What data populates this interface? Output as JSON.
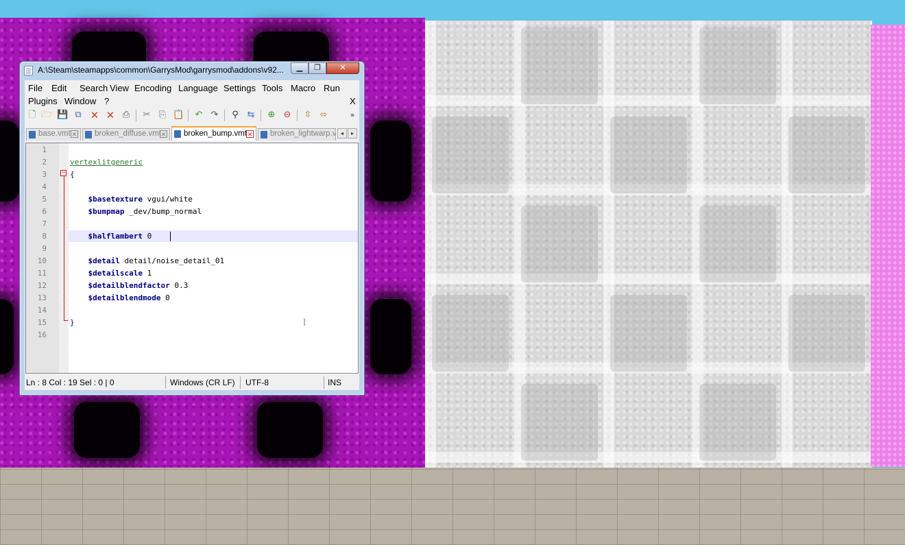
{
  "window": {
    "title": "A:\\Steam\\steamapps\\common\\GarrysMod\\garrysmod\\addons\\v92...",
    "min_glyph": "▁",
    "max_glyph": "❐",
    "close_glyph": "✕"
  },
  "menubar": {
    "row1": [
      "File",
      "Edit",
      "Search",
      "View",
      "Encoding",
      "Language",
      "Settings",
      "Tools",
      "Macro",
      "Run"
    ],
    "row2": [
      "Plugins",
      "Window",
      "?"
    ],
    "close_label": "X"
  },
  "toolbar": {
    "icons": [
      "new-file-icon",
      "open-file-icon",
      "save-icon",
      "save-all-icon",
      "close-icon",
      "close-all-icon",
      "print-icon",
      "cut-icon",
      "copy-icon",
      "paste-icon",
      "undo-icon",
      "redo-icon",
      "find-icon",
      "replace-icon",
      "zoom-in-icon",
      "zoom-out-icon",
      "sync-vertical-icon",
      "sync-horizontal-icon"
    ],
    "overflow": "»"
  },
  "tabs": [
    {
      "label": "base.vmt",
      "active": false
    },
    {
      "label": "broken_diffuse.vmt",
      "active": false
    },
    {
      "label": "broken_bump.vmt",
      "active": true
    },
    {
      "label": "broken_lightwarp.vmt",
      "active": false
    }
  ],
  "tab_nav": {
    "prev": "◂",
    "next": "▸"
  },
  "editor": {
    "lines": [
      {
        "n": "1",
        "kw": "",
        "rest": ""
      },
      {
        "n": "2",
        "kw": "",
        "rest": "vertexlitgeneric"
      },
      {
        "n": "3",
        "kw": "",
        "rest": "{"
      },
      {
        "n": "4",
        "kw": "",
        "rest": ""
      },
      {
        "n": "5",
        "kw": "    $basetexture",
        "rest": " vgui/white"
      },
      {
        "n": "6",
        "kw": "    $bumpmap",
        "rest": " _dev/bump_normal"
      },
      {
        "n": "7",
        "kw": "",
        "rest": ""
      },
      {
        "n": "8",
        "kw": "    $halflambert",
        "rest": " 0"
      },
      {
        "n": "9",
        "kw": "",
        "rest": ""
      },
      {
        "n": "10",
        "kw": "    $detail",
        "rest": " detail/noise_detail_01"
      },
      {
        "n": "11",
        "kw": "    $detailscale",
        "rest": " 1"
      },
      {
        "n": "12",
        "kw": "    $detailblendfactor",
        "rest": " 0.3"
      },
      {
        "n": "13",
        "kw": "    $detailblendmode",
        "rest": " 0"
      },
      {
        "n": "14",
        "kw": "",
        "rest": ""
      },
      {
        "n": "15",
        "kw": "",
        "rest": "}"
      },
      {
        "n": "16",
        "kw": "",
        "rest": ""
      }
    ],
    "fold_marker": "−",
    "ibeam": "I"
  },
  "statusbar": {
    "position": "Ln : 8    Col : 19    Sel : 0 | 0",
    "eol": "Windows (CR LF)",
    "encoding": "UTF-8",
    "mode": "INS"
  },
  "colors": {
    "keyword": "#000080",
    "fold": "#d31010",
    "active_tab_accent": "#f5a43a",
    "wall_left": "#a815b7",
    "wall_right": "#d9d9d9",
    "floor": "#b9b1a4",
    "sky": "#63c5e8"
  }
}
